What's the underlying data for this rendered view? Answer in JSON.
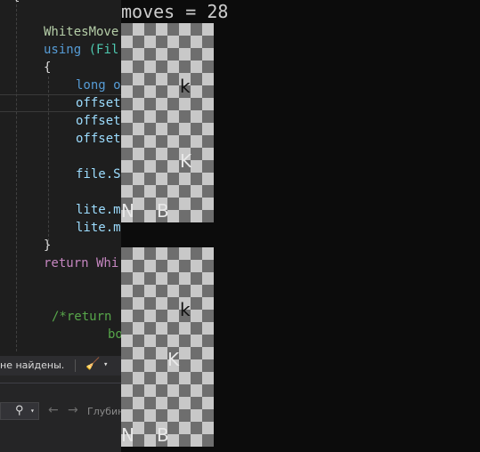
{
  "editor": {
    "lines": [
      {
        "text": "{",
        "color": "#dcdcdc"
      },
      {
        "text": "WhitesMove",
        "color": "#b5cea8"
      },
      {
        "text": "using (Fil",
        "color": "#569cd6",
        "rest_color": "#4ec9b0",
        "keyword": "using",
        "rest": " (Fil"
      },
      {
        "text": "{",
        "color": "#dcdcdc"
      },
      {
        "text": "long o",
        "color": "#569cd6"
      },
      {
        "text": "offset",
        "color": "#9cdcfe"
      },
      {
        "text": "offset",
        "color": "#9cdcfe"
      },
      {
        "text": "offset",
        "color": "#9cdcfe"
      },
      {
        "text": "file.S",
        "color": "#9cdcfe"
      },
      {
        "text": "lite.m",
        "color": "#9cdcfe"
      },
      {
        "text": "lite.m",
        "color": "#9cdcfe"
      },
      {
        "text": "}",
        "color": "#dcdcdc"
      },
      {
        "text": "return Whi",
        "color": "#c586c0"
      },
      {
        "text": "/*return",
        "color": "#57a64a"
      },
      {
        "text": "bo",
        "color": "#57a64a"
      }
    ],
    "status_text": "не найдены.",
    "status_icon": "broom-icon",
    "depth_label": "Глубин",
    "nav_back_glyph": "←",
    "nav_forward_glyph": "→",
    "search_glyph": "⚲",
    "dropdown_glyph": "▾"
  },
  "game": {
    "moves_label": "moves = 28",
    "board_1": {
      "piece_1": "k",
      "piece_2": "K",
      "piece_3": "N",
      "piece_4": "B"
    },
    "board_2": {
      "piece_1": "k",
      "piece_2": "K",
      "piece_3": "N",
      "piece_4": "B"
    },
    "colors": {
      "light_square": "#c8c8c8",
      "dark_square": "#6e6e6e",
      "background": "#0c0c0c"
    }
  }
}
